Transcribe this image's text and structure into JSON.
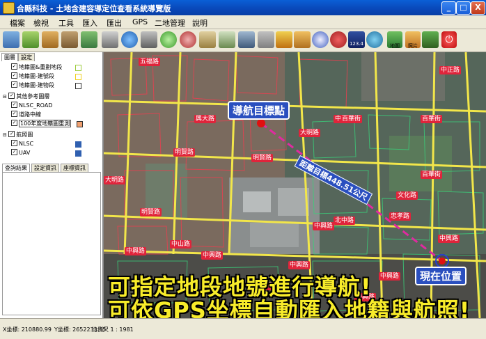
{
  "window": {
    "title": "合縣科技 - 土地含建容導定位查看系統導覽版",
    "min_label": "_",
    "max_label": "□",
    "close_label": "X"
  },
  "menu": [
    {
      "label": "檔案"
    },
    {
      "label": "檢視"
    },
    {
      "label": "工具"
    },
    {
      "label": "匯入"
    },
    {
      "label": "匯出"
    },
    {
      "label": "GPS"
    },
    {
      "label": "二地管理"
    },
    {
      "label": "說明"
    }
  ],
  "toolbar": {
    "icons": [
      "layer-icon",
      "book-icon",
      "house-icon",
      "export-icon",
      "map-icon",
      "print-icon",
      "globe-icon",
      "compass-icon",
      "zoom-in-icon",
      "zoom-out-icon",
      "pan-icon",
      "fit-icon",
      "select-icon",
      "measure-icon",
      "pen-icon",
      "ruler-icon",
      "polygon-icon",
      "gps-icon",
      "satellite-icon",
      "area-icon",
      "image-icon",
      "camera-icon",
      "power-icon"
    ],
    "label_123": "123.4",
    "label_gps": "地圖",
    "label_photo": "照片"
  },
  "left_panel": {
    "tabs": [
      "圖層",
      "設定"
    ],
    "layers": [
      {
        "label": "地籍圖&重劃地段",
        "checked": true,
        "swatch": "#9ccc3c"
      },
      {
        "label": "地籍圖-建號段",
        "checked": true,
        "swatch": "#f0d020"
      },
      {
        "label": "地籍圖-建物段",
        "checked": true,
        "swatch": "#202020"
      },
      {
        "label": "其他參考圖層",
        "checked": true,
        "group": true
      },
      {
        "label": "NLSC_ROAD",
        "checked": true,
        "swatch": "#f0e060"
      },
      {
        "label": "道路中線",
        "checked": true,
        "swatch": ""
      },
      {
        "label": "100年度地籍圖重測",
        "checked": true,
        "swatch": "#f0a070"
      },
      {
        "label": "航照圖",
        "checked": true,
        "group": true
      },
      {
        "label": "NLSC",
        "checked": true,
        "swatch": "#3060b0"
      },
      {
        "label": "UAV",
        "checked": true,
        "swatch": "#3060b0"
      }
    ],
    "bottom_tabs": [
      "查詢結果",
      "設定資訊",
      "座標資訊"
    ]
  },
  "map": {
    "target_label": "導航目標點",
    "distance_label": "距離目標448.51公尺",
    "current_label": "現在位置",
    "road_labels": [
      "五福路",
      "興大路",
      "中華路",
      "明賢路",
      "明賢路",
      "明賢路",
      "大明路",
      "大明路",
      "百華街",
      "百華街",
      "百華街",
      "中興路",
      "中興路",
      "中興路",
      "中興路",
      "中興路",
      "中興路",
      "中興路",
      "北中路",
      "中正路",
      "中山路",
      "文化路",
      "忠孝路",
      "中興路"
    ],
    "banner_line1": "可指定地段地號進行導航!",
    "banner_line2": "可依GPS坐標自動匯入地籍與航照!"
  },
  "statusbar": {
    "x_coord": "X坐標: 210880.99",
    "y_coord": "Y坐標: 2652233.55",
    "scale": "比例尺 1 : 1981"
  }
}
